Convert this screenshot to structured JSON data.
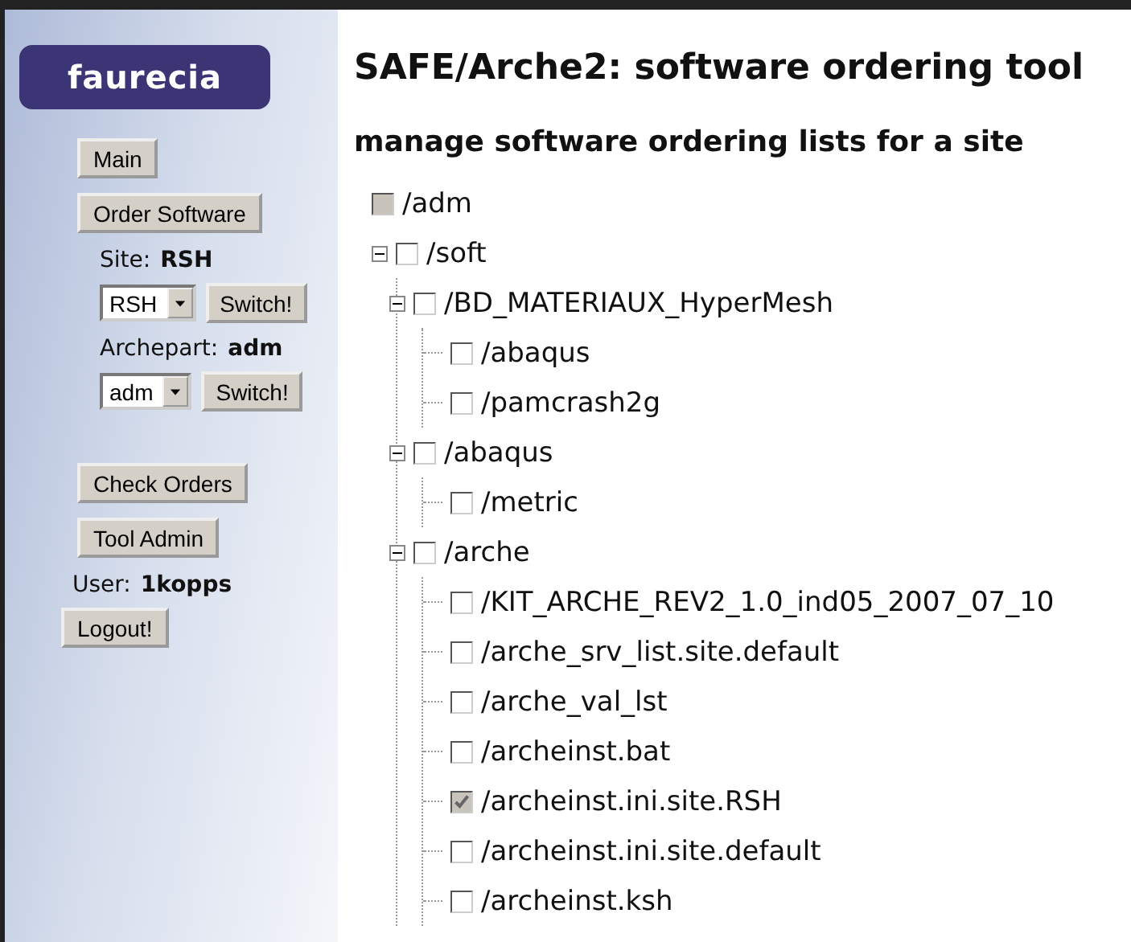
{
  "sidebar": {
    "logo": "faurecia",
    "items": [
      {
        "kind": "button",
        "label": "Main"
      },
      {
        "kind": "button",
        "label": "Order Software"
      },
      {
        "kind": "info",
        "label": "Site:",
        "value": "RSH"
      },
      {
        "kind": "picker",
        "value": "RSH",
        "button": "Switch!"
      },
      {
        "kind": "info",
        "label": "Archepart:",
        "value": "adm"
      },
      {
        "kind": "picker",
        "value": "adm",
        "button": "Switch!"
      },
      {
        "kind": "spacer"
      },
      {
        "kind": "button",
        "label": "Check Orders"
      },
      {
        "kind": "button",
        "label": "Tool Admin"
      },
      {
        "kind": "user",
        "label": "User:",
        "value": "1kopps"
      },
      {
        "kind": "logout",
        "label": "Logout!"
      }
    ]
  },
  "title": "SAFE/Arche2: software ordering tool",
  "subtitle": "manage software ordering lists for a site",
  "tree": [
    {
      "label": "/adm",
      "checked": false,
      "disabled": true
    },
    {
      "label": "/soft",
      "checked": false,
      "disabled": false,
      "expanded": true,
      "children": [
        {
          "label": "/BD_MATERIAUX_HyperMesh",
          "checked": false,
          "disabled": false,
          "expanded": true,
          "children": [
            {
              "label": "/abaqus",
              "checked": false,
              "disabled": false
            },
            {
              "label": "/pamcrash2g",
              "checked": false,
              "disabled": false
            }
          ]
        },
        {
          "label": "/abaqus",
          "checked": false,
          "disabled": false,
          "expanded": true,
          "children": [
            {
              "label": "/metric",
              "checked": false,
              "disabled": false
            }
          ]
        },
        {
          "label": "/arche",
          "checked": false,
          "disabled": false,
          "expanded": true,
          "children": [
            {
              "label": "/KIT_ARCHE_REV2_1.0_ind05_2007_07_10",
              "checked": false,
              "disabled": false
            },
            {
              "label": "/arche_srv_list.site.default",
              "checked": false,
              "disabled": false
            },
            {
              "label": "/arche_val_lst",
              "checked": false,
              "disabled": false
            },
            {
              "label": "/archeinst.bat",
              "checked": false,
              "disabled": false
            },
            {
              "label": "/archeinst.ini.site.RSH",
              "checked": true,
              "disabled": true
            },
            {
              "label": "/archeinst.ini.site.default",
              "checked": false,
              "disabled": false
            },
            {
              "label": "/archeinst.ksh",
              "checked": false,
              "disabled": false
            }
          ]
        }
      ]
    }
  ]
}
